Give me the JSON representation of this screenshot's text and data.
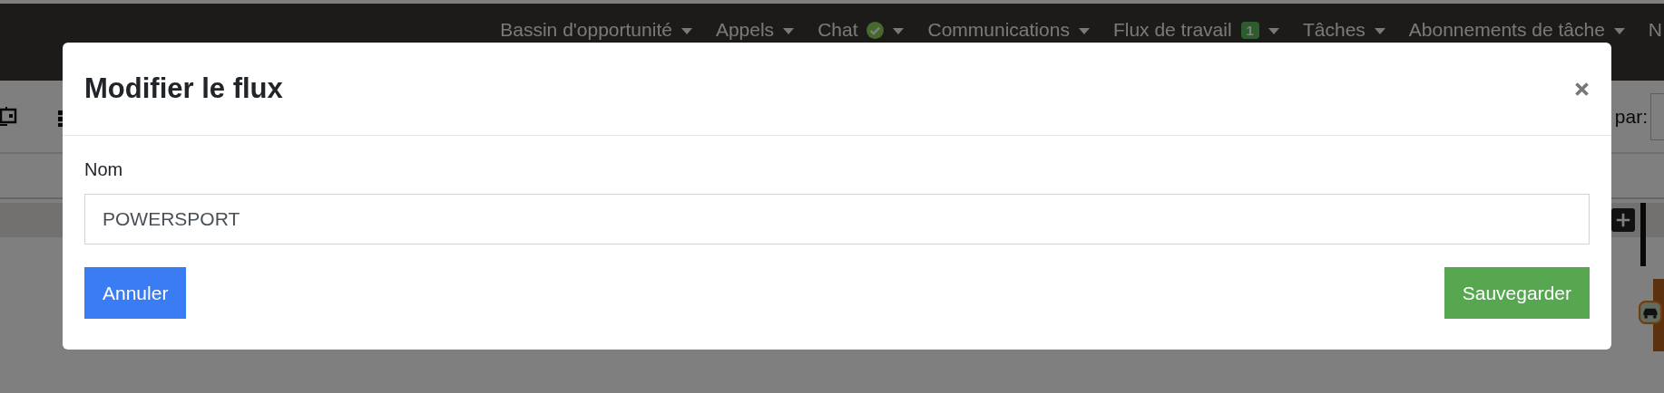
{
  "nav": [
    {
      "label": "Bassin d'opportunité",
      "kind": "plain",
      "caret": true
    },
    {
      "label": "Appels",
      "kind": "plain",
      "caret": true
    },
    {
      "label": "Chat",
      "kind": "status",
      "caret": true
    },
    {
      "label": "Communications",
      "kind": "plain",
      "caret": true
    },
    {
      "label": "Flux de travail",
      "kind": "count",
      "count": "1",
      "caret": true
    },
    {
      "label": "Tâches",
      "kind": "plain",
      "caret": true
    },
    {
      "label": "Abonnements de tâche",
      "kind": "plain",
      "caret": true
    },
    {
      "label": "N",
      "kind": "plain",
      "caret": false
    }
  ],
  "toolbar": {
    "sort_label": "par:"
  },
  "modal": {
    "title": "Modifier le flux",
    "field_label": "Nom",
    "field_value": "POWERSPORT",
    "cancel": "Annuler",
    "save": "Sauvegarder"
  }
}
